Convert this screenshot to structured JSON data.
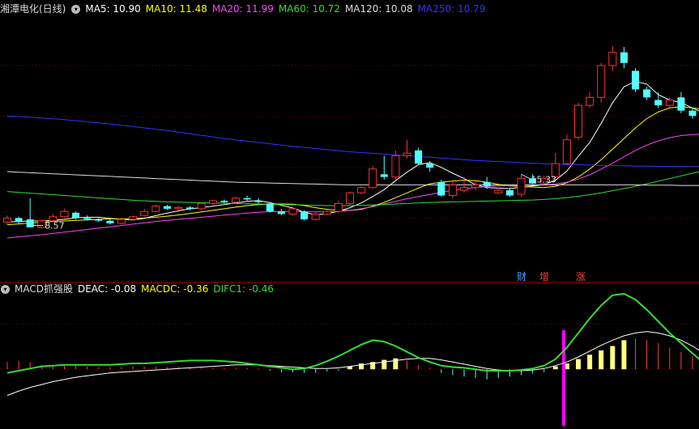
{
  "header": {
    "title": "湘潭电化(日线)",
    "ma": [
      {
        "label": "MA5: 10.90",
        "color": "#ffffff"
      },
      {
        "label": "MA10: 11.48",
        "color": "#ffff00"
      },
      {
        "label": "MA20: 11.99",
        "color": "#ff44ff"
      },
      {
        "label": "MA60: 10.72",
        "color": "#33dd33"
      },
      {
        "label": "MA120: 10.08",
        "color": "#dddddd"
      },
      {
        "label": "MA250: 10.79",
        "color": "#3333ff"
      }
    ]
  },
  "sub_header": {
    "title": "MACD抓强股",
    "items": [
      {
        "label": "DEAC: -0.08",
        "color": "#ffffff"
      },
      {
        "label": "MACDC: -0.36",
        "color": "#ffff00"
      },
      {
        "label": "DIFC1: -0.46",
        "color": "#33dd33"
      }
    ]
  },
  "markers": [
    {
      "text": "财",
      "color": "#4aa0ff"
    },
    {
      "text": "增",
      "color": "#ff4040"
    },
    {
      "text": "涨",
      "color": "#ff4040"
    }
  ],
  "colors": {
    "up": "#ff3030",
    "down": "#54ffff",
    "bg": "#000000",
    "grid": "#7a0000"
  },
  "chart_data": {
    "type": "candlestick",
    "annotations": [
      {
        "text": "15.33",
        "bar": 45
      },
      {
        "text": "8.57",
        "bar": 2
      }
    ],
    "price_ylim": [
      7.0,
      16.4
    ],
    "candles": [
      [
        8.7,
        8.85,
        8.6,
        8.95
      ],
      [
        8.85,
        8.7,
        8.65,
        8.9
      ],
      [
        8.8,
        8.5,
        8.57,
        9.6
      ],
      [
        8.5,
        8.75,
        8.45,
        8.8
      ],
      [
        8.75,
        8.9,
        8.7,
        9.0
      ],
      [
        8.9,
        9.1,
        8.85,
        9.2
      ],
      [
        9.05,
        8.85,
        8.8,
        9.1
      ],
      [
        8.85,
        8.8,
        8.75,
        8.95
      ],
      [
        8.8,
        8.75,
        8.7,
        8.85
      ],
      [
        8.75,
        8.65,
        8.6,
        8.8
      ],
      [
        8.65,
        8.8,
        8.6,
        8.85
      ],
      [
        8.8,
        8.9,
        8.75,
        8.95
      ],
      [
        8.95,
        9.1,
        8.9,
        9.2
      ],
      [
        9.1,
        9.3,
        9.05,
        9.35
      ],
      [
        9.3,
        9.2,
        9.15,
        9.35
      ],
      [
        9.2,
        9.25,
        9.15,
        9.3
      ],
      [
        9.25,
        9.2,
        9.15,
        9.3
      ],
      [
        9.2,
        9.4,
        9.15,
        9.45
      ],
      [
        9.4,
        9.5,
        9.35,
        9.55
      ],
      [
        9.5,
        9.45,
        9.4,
        9.55
      ],
      [
        9.45,
        9.6,
        9.4,
        9.65
      ],
      [
        9.6,
        9.55,
        9.5,
        9.7
      ],
      [
        9.5,
        9.45,
        9.4,
        9.6
      ],
      [
        9.4,
        9.1,
        9.05,
        9.45
      ],
      [
        9.1,
        9.0,
        8.95,
        9.2
      ],
      [
        9.0,
        9.2,
        8.95,
        9.25
      ],
      [
        9.1,
        8.8,
        8.75,
        9.15
      ],
      [
        8.8,
        9.0,
        8.75,
        9.05
      ],
      [
        9.0,
        9.1,
        8.95,
        9.15
      ],
      [
        9.1,
        9.4,
        9.05,
        9.5
      ],
      [
        9.4,
        9.8,
        9.35,
        9.85
      ],
      [
        9.8,
        10.0,
        9.75,
        10.05
      ],
      [
        10.0,
        10.7,
        9.95,
        10.8
      ],
      [
        10.5,
        10.4,
        10.3,
        11.2
      ],
      [
        10.4,
        11.2,
        10.3,
        11.4
      ],
      [
        11.2,
        11.3,
        11.1,
        11.8
      ],
      [
        11.4,
        10.9,
        10.85,
        11.5
      ],
      [
        10.9,
        10.75,
        10.6,
        11.0
      ],
      [
        10.2,
        9.7,
        9.65,
        10.3
      ],
      [
        9.7,
        10.1,
        9.6,
        10.2
      ],
      [
        9.9,
        10.0,
        9.8,
        10.4
      ],
      [
        10.0,
        10.1,
        9.9,
        10.3
      ],
      [
        10.2,
        10.05,
        9.95,
        10.4
      ],
      [
        9.8,
        9.9,
        9.75,
        10.0
      ],
      [
        9.9,
        9.7,
        9.65,
        10.0
      ],
      [
        9.75,
        10.35,
        9.65,
        10.5
      ],
      [
        10.35,
        10.15,
        10.1,
        10.5
      ],
      [
        10.15,
        10.35,
        10.1,
        10.45
      ],
      [
        10.4,
        10.9,
        10.35,
        11.3
      ],
      [
        10.9,
        11.8,
        10.85,
        12.0
      ],
      [
        11.9,
        13.1,
        11.8,
        13.2
      ],
      [
        13.1,
        13.4,
        13.0,
        13.6
      ],
      [
        13.4,
        14.6,
        13.2,
        14.7
      ],
      [
        14.6,
        15.1,
        14.4,
        15.33
      ],
      [
        15.1,
        14.7,
        14.5,
        15.3
      ],
      [
        14.4,
        13.7,
        13.6,
        14.5
      ],
      [
        13.7,
        13.4,
        13.3,
        13.8
      ],
      [
        13.3,
        13.1,
        13.0,
        13.6
      ],
      [
        13.1,
        13.3,
        13.0,
        13.4
      ],
      [
        13.4,
        12.9,
        12.8,
        13.6
      ],
      [
        12.9,
        12.7,
        12.6,
        13.0
      ],
      [
        12.6,
        12.5,
        12.4,
        12.8
      ],
      [
        12.5,
        12.4,
        12.3,
        12.6
      ]
    ],
    "ma_series": [
      {
        "name": "MA5",
        "color": "#ffffff",
        "values": [
          8.7,
          8.72,
          8.74,
          8.74,
          8.76,
          8.8,
          8.86,
          8.88,
          8.88,
          8.84,
          8.8,
          8.78,
          8.84,
          8.94,
          9.04,
          9.12,
          9.2,
          9.24,
          9.3,
          9.36,
          9.42,
          9.48,
          9.51,
          9.43,
          9.33,
          9.23,
          9.07,
          8.97,
          9.02,
          9.1,
          9.24,
          9.42,
          9.66,
          9.92,
          10.26,
          10.58,
          10.86,
          10.94,
          10.76,
          10.54,
          10.34,
          10.1,
          10.0,
          9.98,
          9.96,
          10.01,
          10.06,
          10.11,
          10.28,
          10.62,
          11.18,
          11.7,
          12.42,
          13.2,
          13.8,
          14.0,
          13.9,
          13.5,
          13.3,
          13.2,
          13.0,
          12.8,
          12.65
        ]
      },
      {
        "name": "MA10",
        "color": "#ffff00",
        "values": [
          8.6,
          8.63,
          8.66,
          8.69,
          8.72,
          8.74,
          8.76,
          8.78,
          8.8,
          8.82,
          8.82,
          8.83,
          8.85,
          8.88,
          8.92,
          8.97,
          9.02,
          9.08,
          9.14,
          9.2,
          9.26,
          9.32,
          9.36,
          9.38,
          9.38,
          9.37,
          9.32,
          9.24,
          9.18,
          9.14,
          9.14,
          9.18,
          9.3,
          9.44,
          9.62,
          9.8,
          9.98,
          10.14,
          10.2,
          10.24,
          10.28,
          10.26,
          10.2,
          10.12,
          10.06,
          10.04,
          10.02,
          10.0,
          10.05,
          10.18,
          10.4,
          10.7,
          11.05,
          11.45,
          11.85,
          12.25,
          12.6,
          12.85,
          13.0,
          13.05,
          13.0,
          12.95,
          12.88
        ]
      },
      {
        "name": "MA20",
        "color": "#ff44ff",
        "values": [
          8.1,
          8.14,
          8.18,
          8.22,
          8.27,
          8.32,
          8.37,
          8.42,
          8.47,
          8.52,
          8.57,
          8.62,
          8.67,
          8.72,
          8.76,
          8.8,
          8.84,
          8.88,
          8.92,
          8.96,
          9.0,
          9.04,
          9.07,
          9.09,
          9.1,
          9.1,
          9.09,
          9.08,
          9.08,
          9.1,
          9.14,
          9.2,
          9.28,
          9.38,
          9.48,
          9.58,
          9.66,
          9.74,
          9.82,
          9.9,
          9.96,
          10.0,
          10.04,
          10.06,
          10.07,
          10.08,
          10.09,
          10.1,
          10.13,
          10.2,
          10.32,
          10.48,
          10.7,
          10.92,
          11.16,
          11.4,
          11.6,
          11.76,
          11.88,
          11.96,
          12.0,
          12.02,
          12.0
        ]
      },
      {
        "name": "MA60",
        "color": "#33dd33",
        "values": [
          9.85,
          9.82,
          9.79,
          9.76,
          9.73,
          9.7,
          9.67,
          9.64,
          9.61,
          9.58,
          9.55,
          9.52,
          9.5,
          9.48,
          9.46,
          9.45,
          9.44,
          9.43,
          9.42,
          9.41,
          9.4,
          9.39,
          9.38,
          9.37,
          9.36,
          9.35,
          9.34,
          9.33,
          9.32,
          9.32,
          9.32,
          9.33,
          9.34,
          9.36,
          9.38,
          9.4,
          9.42,
          9.44,
          9.45,
          9.46,
          9.47,
          9.48,
          9.49,
          9.5,
          9.51,
          9.52,
          9.53,
          9.55,
          9.58,
          9.62,
          9.67,
          9.73,
          9.8,
          9.88,
          9.96,
          10.05,
          10.14,
          10.24,
          10.34,
          10.44,
          10.54,
          10.63,
          10.72
        ]
      },
      {
        "name": "MA120",
        "color": "#dddddd",
        "values": [
          10.6,
          10.58,
          10.56,
          10.54,
          10.52,
          10.5,
          10.48,
          10.46,
          10.44,
          10.42,
          10.4,
          10.38,
          10.36,
          10.34,
          10.32,
          10.3,
          10.28,
          10.26,
          10.24,
          10.22,
          10.2,
          10.19,
          10.18,
          10.17,
          10.16,
          10.15,
          10.14,
          10.13,
          10.12,
          10.11,
          10.1,
          10.1,
          10.1,
          10.1,
          10.1,
          10.1,
          10.1,
          10.1,
          10.1,
          10.1,
          10.1,
          10.1,
          10.1,
          10.1,
          10.1,
          10.1,
          10.1,
          10.1,
          10.1,
          10.1,
          10.1,
          10.1,
          10.1,
          10.1,
          10.1,
          10.1,
          10.09,
          10.09,
          10.09,
          10.08,
          10.08,
          10.08,
          10.08
        ]
      },
      {
        "name": "MA250",
        "color": "#3333ff",
        "values": [
          12.7,
          12.68,
          12.65,
          12.62,
          12.59,
          12.56,
          12.52,
          12.48,
          12.44,
          12.4,
          12.35,
          12.3,
          12.25,
          12.2,
          12.15,
          12.09,
          12.03,
          11.97,
          11.91,
          11.85,
          11.8,
          11.75,
          11.7,
          11.65,
          11.6,
          11.55,
          11.51,
          11.47,
          11.43,
          11.39,
          11.35,
          11.32,
          11.29,
          11.26,
          11.23,
          11.2,
          11.17,
          11.14,
          11.11,
          11.08,
          11.05,
          11.02,
          11.0,
          10.98,
          10.96,
          10.94,
          10.92,
          10.9,
          10.88,
          10.87,
          10.86,
          10.85,
          10.84,
          10.83,
          10.82,
          10.81,
          10.81,
          10.8,
          10.8,
          10.8,
          10.79,
          10.79,
          10.79
        ]
      }
    ],
    "macd_ylim": [
      -0.8,
      1.05
    ],
    "macd_hist": [
      0.1,
      0.12,
      0.1,
      0.06,
      0.05,
      0.06,
      0.05,
      0.04,
      0.03,
      0.03,
      0.03,
      0.04,
      0.04,
      0.04,
      0.03,
      0.03,
      0.03,
      0.02,
      0.02,
      0.02,
      0.02,
      0.02,
      0.01,
      -0.02,
      -0.04,
      -0.04,
      -0.05,
      -0.05,
      -0.03,
      -0.02,
      0.04,
      0.08,
      0.1,
      0.13,
      0.15,
      0.12,
      0.06,
      0.02,
      -0.05,
      -0.08,
      -0.1,
      -0.12,
      -0.14,
      -0.12,
      -0.1,
      -0.08,
      -0.06,
      -0.04,
      0.04,
      0.08,
      0.14,
      0.2,
      0.26,
      0.32,
      0.4,
      0.42,
      0.4,
      0.36,
      0.3,
      0.24,
      0.18,
      -0.18,
      -0.28
    ],
    "macd_hist_yellow": [
      false,
      false,
      false,
      false,
      false,
      false,
      false,
      false,
      false,
      false,
      false,
      false,
      false,
      false,
      false,
      false,
      false,
      false,
      false,
      false,
      false,
      false,
      false,
      false,
      false,
      false,
      false,
      false,
      false,
      false,
      true,
      true,
      true,
      true,
      true,
      false,
      false,
      false,
      false,
      false,
      false,
      false,
      false,
      false,
      false,
      false,
      false,
      false,
      true,
      true,
      true,
      true,
      true,
      true,
      true,
      false,
      false,
      false,
      false,
      false,
      false,
      false,
      false
    ],
    "macd_spike_bar": 50,
    "deac": [
      -0.36,
      -0.3,
      -0.25,
      -0.21,
      -0.17,
      -0.14,
      -0.11,
      -0.09,
      -0.07,
      -0.05,
      -0.04,
      -0.03,
      -0.02,
      -0.01,
      0.0,
      0.01,
      0.02,
      0.03,
      0.04,
      0.05,
      0.06,
      0.06,
      0.06,
      0.05,
      0.04,
      0.03,
      0.02,
      0.01,
      0.01,
      0.02,
      0.04,
      0.06,
      0.08,
      0.1,
      0.12,
      0.14,
      0.15,
      0.15,
      0.13,
      0.1,
      0.07,
      0.04,
      0.01,
      -0.01,
      -0.02,
      -0.02,
      -0.01,
      0.01,
      0.05,
      0.1,
      0.17,
      0.25,
      0.33,
      0.4,
      0.46,
      0.5,
      0.52,
      0.5,
      0.46,
      0.4,
      0.32,
      0.22,
      0.12
    ],
    "difc": [
      -0.05,
      -0.02,
      0.01,
      0.04,
      0.05,
      0.06,
      0.06,
      0.06,
      0.06,
      0.06,
      0.07,
      0.08,
      0.08,
      0.09,
      0.1,
      0.11,
      0.12,
      0.12,
      0.12,
      0.11,
      0.1,
      0.08,
      0.06,
      0.04,
      0.02,
      0.0,
      0.01,
      0.05,
      0.11,
      0.18,
      0.26,
      0.34,
      0.4,
      0.38,
      0.32,
      0.24,
      0.16,
      0.1,
      0.05,
      0.03,
      0.02,
      0.0,
      -0.02,
      -0.02,
      -0.02,
      -0.01,
      0.01,
      0.05,
      0.14,
      0.3,
      0.5,
      0.7,
      0.88,
      1.02,
      1.04,
      0.96,
      0.82,
      0.66,
      0.5,
      0.36,
      0.22,
      0.08,
      -0.05
    ]
  }
}
